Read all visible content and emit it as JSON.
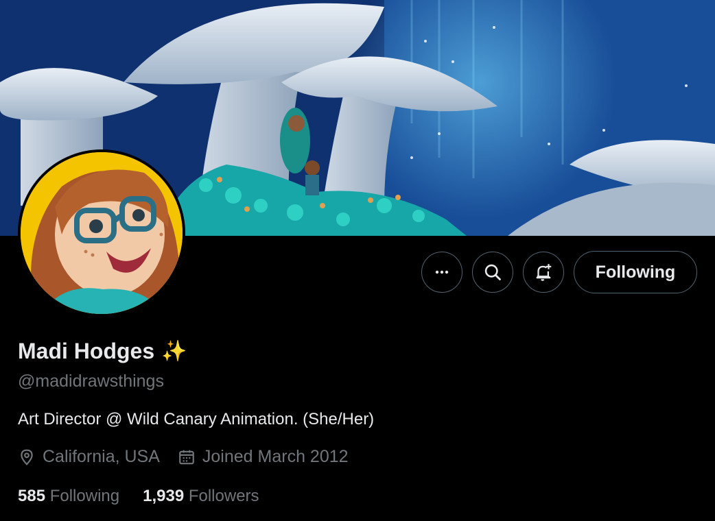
{
  "profile": {
    "display_name": "Madi Hodges",
    "emoji": "✨",
    "handle": "@madidrawsthings",
    "bio": "Art Director @ Wild Canary Animation. (She/Her)",
    "location": "California, USA",
    "joined": "Joined March 2012",
    "following_count": "585",
    "following_label": "Following",
    "followers_count": "1,939",
    "followers_label": "Followers"
  },
  "actions": {
    "more_icon": "more-dots-icon",
    "search_icon": "search-icon",
    "notify_icon": "bell-plus-icon",
    "follow_label": "Following"
  },
  "colors": {
    "background": "#000000",
    "primary_text": "#e7e9ea",
    "secondary_text": "#71767b",
    "border": "#536471",
    "avatar_bg": "#f5c400"
  }
}
